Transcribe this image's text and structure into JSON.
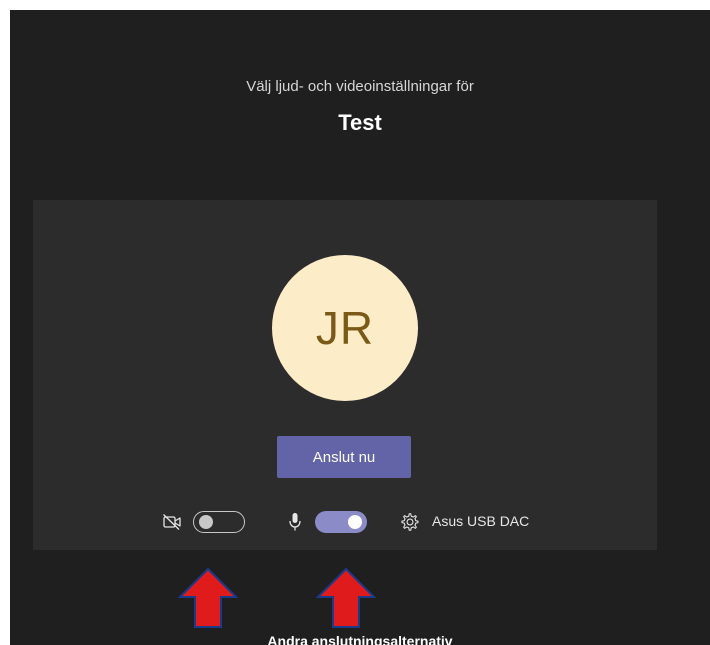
{
  "meeting": {
    "subtitle": "Välj ljud- och videoinställningar för",
    "title": "Test"
  },
  "preview": {
    "avatar_initials": "JR",
    "join_button_label": "Anslut nu"
  },
  "controls": {
    "camera": {
      "icon": "camera-off-icon",
      "enabled": false
    },
    "microphone": {
      "icon": "microphone-icon",
      "enabled": true
    },
    "device": {
      "icon": "gear-icon",
      "label": "Asus USB DAC"
    }
  },
  "annotations": {
    "arrows": [
      "red-arrow-up",
      "red-arrow-up"
    ]
  },
  "footer": {
    "other_options_label": "Andra anslutningsalternativ"
  },
  "colors": {
    "background": "#1f1f1f",
    "panel": "#2d2c2c",
    "accent": "#6264a7",
    "toggle_on": "#8b8cc7",
    "avatar_bg": "#fcedc8",
    "avatar_text": "#7a5a16",
    "arrow_fill": "#e01b1b",
    "arrow_stroke": "#1a3a8c"
  }
}
